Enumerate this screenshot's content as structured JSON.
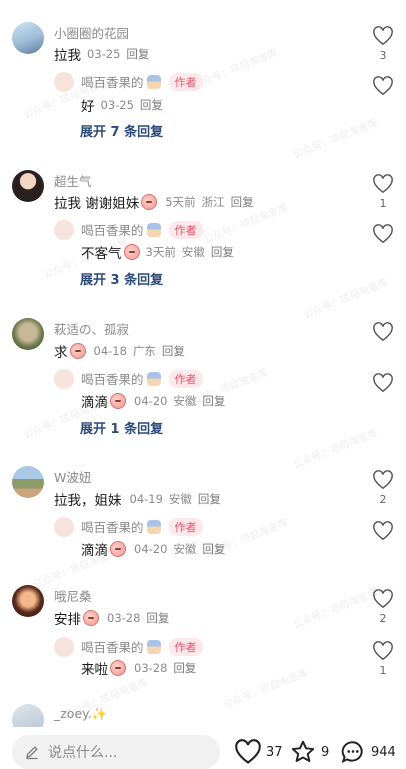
{
  "watermark": "公众号：项目淘金库",
  "comments": [
    {
      "username": "小圈圈的花园",
      "text": "拉我",
      "time": "03-25",
      "reply_label": "回复",
      "likes": "3",
      "reply": {
        "username": "喝百香果的",
        "badge": "作者",
        "text": "好",
        "time": "03-25",
        "reply_label": "回复",
        "likes": ""
      },
      "expand": "展开 7 条回复"
    },
    {
      "username": "超生气",
      "text": "拉我 谢谢姐妹",
      "time": "5天前",
      "location": "浙江",
      "reply_label": "回复",
      "likes": "1",
      "reply": {
        "username": "喝百香果的",
        "badge": "作者",
        "text": "不客气",
        "time": "3天前",
        "location": "安徽",
        "reply_label": "回复",
        "likes": ""
      },
      "expand": "展开 3 条回复"
    },
    {
      "username": "萩适の、孤寂",
      "text": "求",
      "time": "04-18",
      "location": "广东",
      "reply_label": "回复",
      "likes": "",
      "reply": {
        "username": "喝百香果的",
        "badge": "作者",
        "text": "滴滴",
        "time": "04-20",
        "location": "安徽",
        "reply_label": "回复",
        "likes": ""
      },
      "expand": "展开 1 条回复"
    },
    {
      "username": "W波妞",
      "text": "拉我，姐妹",
      "time": "04-19",
      "location": "安徽",
      "reply_label": "回复",
      "likes": "2",
      "reply": {
        "username": "喝百香果的",
        "badge": "作者",
        "text": "滴滴",
        "time": "04-20",
        "location": "安徽",
        "reply_label": "回复",
        "likes": ""
      }
    },
    {
      "username": "哦尼桑",
      "text": "安排",
      "time": "03-28",
      "reply_label": "回复",
      "likes": "2",
      "reply": {
        "username": "喝百香果的",
        "badge": "作者",
        "text": "来啦",
        "time": "03-28",
        "reply_label": "回复",
        "likes": "1"
      }
    },
    {
      "username": "_zoey.✨"
    }
  ],
  "bottom_bar": {
    "input_placeholder": "说点什么...",
    "likes": "37",
    "favorites": "9",
    "comments": "944"
  },
  "colors": {
    "author_badge": "#e8526b",
    "expand_link": "#2c4a7a"
  }
}
